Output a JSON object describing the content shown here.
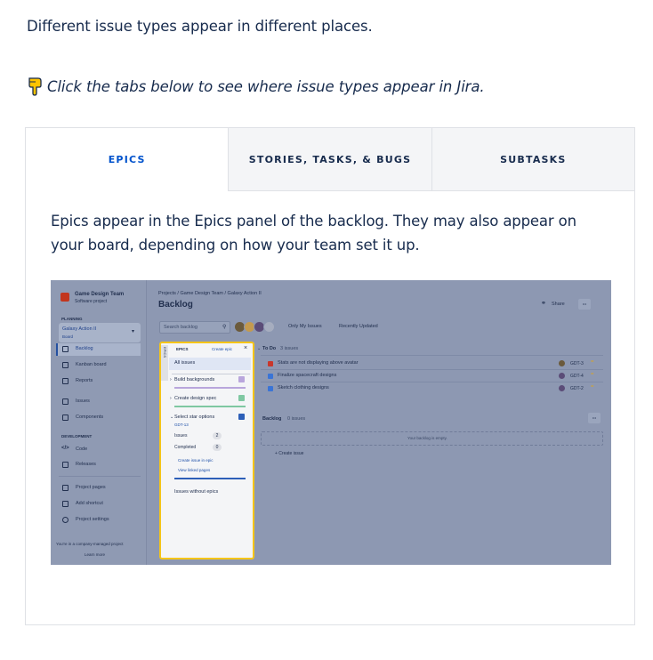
{
  "intro_text": "Different issue types appear in different places.",
  "hint": {
    "icon": "pointing-hand-icon",
    "text": "Click the tabs below to see where issue types appear in Jira."
  },
  "tabs": [
    {
      "label": "EPICS",
      "active": true
    },
    {
      "label": "STORIES, TASKS, & BUGS",
      "active": false
    },
    {
      "label": "SUBTASKS",
      "active": false
    }
  ],
  "description": "Epics appear in the Epics panel of the backlog. They may also appear on your board, depending on how your team set it up.",
  "colors": {
    "accent": "#0052cc",
    "text": "#172b4d",
    "highlight": "#f5c518",
    "overlay": "#8d98b2"
  },
  "screenshot": {
    "sidebar": {
      "project_name": "Game Design Team",
      "project_type": "Software project",
      "planning_heading": "PLANNING",
      "board_name": "Galaxy Action II",
      "board_sub": "Board",
      "nav": [
        "Backlog",
        "Kanban board",
        "Reports",
        "Issues",
        "Components"
      ],
      "development_heading": "DEVELOPMENT",
      "dev_nav": [
        "Code",
        "Releases"
      ],
      "bottom_nav": [
        "Project pages",
        "Add shortcut",
        "Project settings"
      ],
      "footer": "You're in a company-managed project",
      "learn_more": "Learn more"
    },
    "breadcrumb": "Projects  /  Game Design Team  /  Galaxy Action II",
    "title": "Backlog",
    "share": "Share",
    "more": "•••",
    "search_placeholder": "Search backlog",
    "filters": [
      "Only My Issues",
      "Recently Updated"
    ],
    "epics_panel": {
      "side_label": "EPICS",
      "heading": "EPICS",
      "create": "Create epic",
      "close": "×",
      "all_issues": "All issues",
      "items": [
        "Build backgrounds",
        "Create design spec",
        "Select star options"
      ],
      "epic_key": "GDT-13",
      "issues_label": "Issues",
      "issues_count": "2",
      "completed_label": "Completed",
      "completed_count": "0",
      "links": [
        "Create issue in epic",
        "View linked pages"
      ],
      "without": "Issues without epics"
    },
    "todo": {
      "label": "To Do",
      "count": "3 issues"
    },
    "issues": [
      {
        "summary": "Stats are not displaying above avatar",
        "key": "GDT-3"
      },
      {
        "summary": "Finalize spacecraft designs",
        "key": "GDT-4"
      },
      {
        "summary": "Sketch clothing designs",
        "key": "GDT-2"
      }
    ],
    "backlog": {
      "label": "Backlog",
      "count": "0 issues",
      "empty": "Your backlog is empty.",
      "create": "+  Create issue"
    }
  }
}
